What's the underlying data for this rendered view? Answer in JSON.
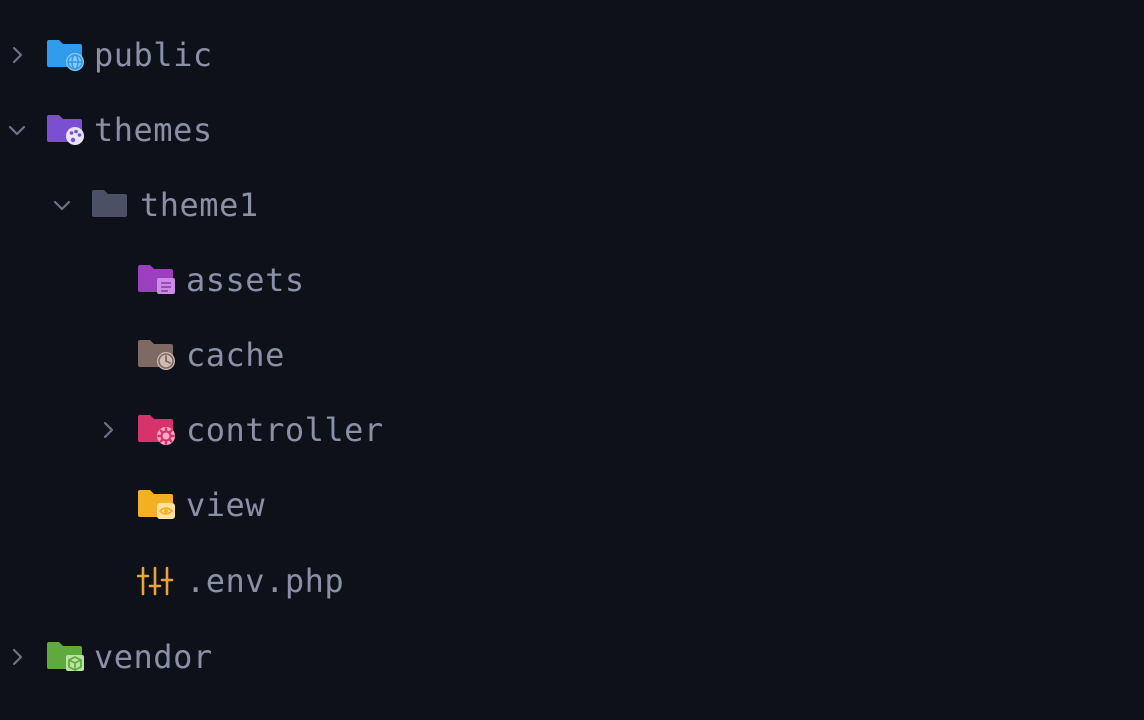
{
  "tree": {
    "items": [
      {
        "label": "public",
        "depth": 0,
        "expandable": true,
        "expanded": false,
        "icon": "folder-public-icon",
        "color": "#2f9bea"
      },
      {
        "label": "themes",
        "depth": 0,
        "expandable": true,
        "expanded": true,
        "icon": "folder-theme-icon",
        "color": "#7a4fd2"
      },
      {
        "label": "theme1",
        "depth": 1,
        "expandable": true,
        "expanded": true,
        "icon": "folder-icon",
        "color": "#4b5064"
      },
      {
        "label": "assets",
        "depth": 2,
        "expandable": false,
        "expanded": false,
        "icon": "folder-assets-icon",
        "color": "#9b3fbf"
      },
      {
        "label": "cache",
        "depth": 2,
        "expandable": false,
        "expanded": false,
        "icon": "folder-cache-icon",
        "color": "#7e6a62"
      },
      {
        "label": "controller",
        "depth": 2,
        "expandable": true,
        "expanded": false,
        "icon": "folder-controller-icon",
        "color": "#d6336c"
      },
      {
        "label": "view",
        "depth": 2,
        "expandable": false,
        "expanded": false,
        "icon": "folder-view-icon",
        "color": "#f4b023"
      },
      {
        "label": ".env.php",
        "depth": 2,
        "expandable": false,
        "expanded": false,
        "icon": "env-settings-icon",
        "color": "#e8a33a"
      },
      {
        "label": "vendor",
        "depth": 0,
        "expandable": true,
        "expanded": false,
        "icon": "folder-vendor-icon",
        "color": "#5faa3c"
      }
    ]
  },
  "colors": {
    "background": "#0f111a",
    "text": "#8a90a6",
    "chevron": "#6c7289"
  }
}
